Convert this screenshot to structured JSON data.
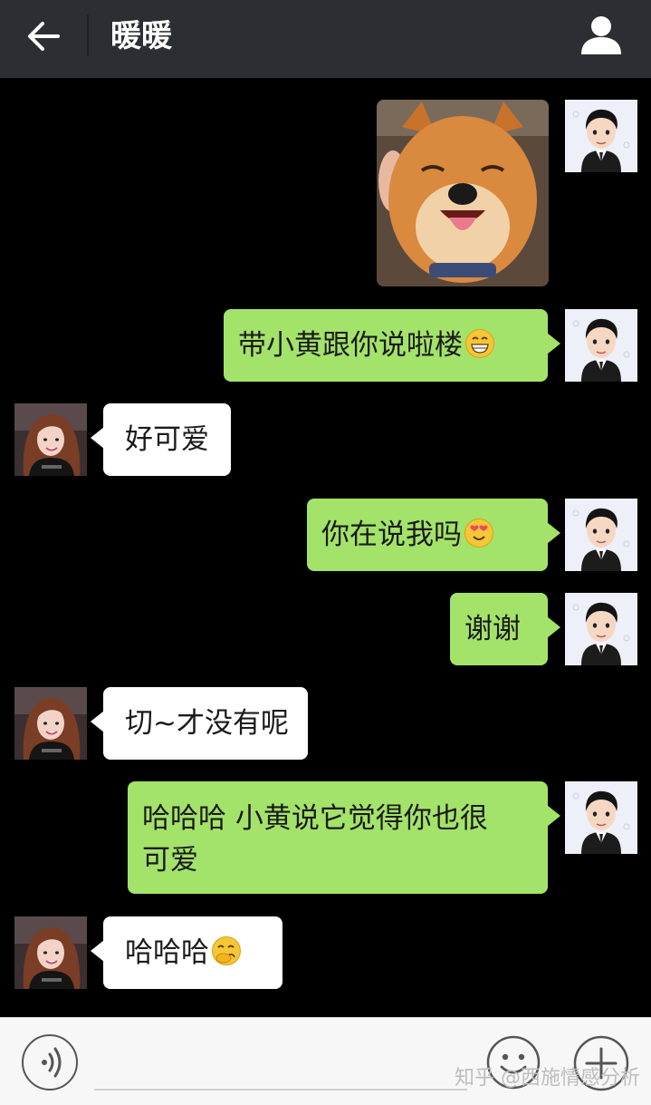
{
  "header": {
    "title": "暖暖",
    "back_icon": "arrow-left-icon",
    "profile_icon": "person-icon",
    "background": "#2b2f33"
  },
  "colors": {
    "chat_background": "#000000",
    "outgoing_bubble": "#a4e36a",
    "incoming_bubble": "#ffffff"
  },
  "messages": [
    {
      "sender": "me",
      "type": "image",
      "content": "shiba-inu-photo"
    },
    {
      "sender": "me",
      "type": "text",
      "text": "带小黄跟你说啦楼",
      "emoji": "grin-emoji"
    },
    {
      "sender": "contact",
      "type": "text",
      "text": "好可爱"
    },
    {
      "sender": "me",
      "type": "text",
      "text": "你在说我吗",
      "emoji": "heart-eyes-emoji"
    },
    {
      "sender": "me",
      "type": "text",
      "text": "谢谢"
    },
    {
      "sender": "contact",
      "type": "text",
      "text": "切~才没有呢"
    },
    {
      "sender": "me",
      "type": "text",
      "line1": "哈哈哈 小黄说它觉得你也很",
      "line2": "可爱"
    },
    {
      "sender": "contact",
      "type": "text",
      "text": "哈哈哈",
      "emoji": "giggle-emoji"
    }
  ],
  "bottom_bar": {
    "voice_icon": "voice-icon",
    "emoji_icon": "smiley-icon",
    "plus_icon": "plus-icon"
  },
  "watermark": "知乎 @西施情感分析"
}
